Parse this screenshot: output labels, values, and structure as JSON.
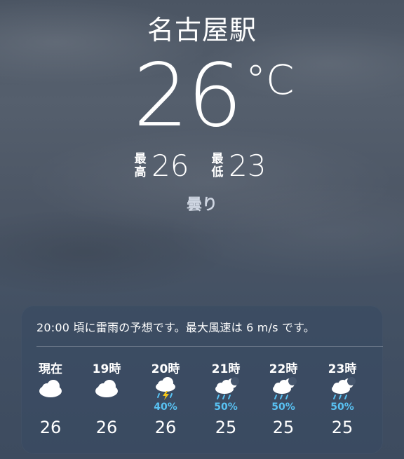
{
  "location": "名古屋駅",
  "current": {
    "temperature": "26",
    "unit": "°C",
    "high_label": "最高",
    "high": "26",
    "low_label": "最低",
    "low": "23",
    "condition": "曇り"
  },
  "forecast_card": {
    "summary": "20:00 頃に雷雨の予想です。最大風速は 6 m/s です。",
    "hours": [
      {
        "label": "現在",
        "icon": "cloud-icon",
        "precip": "",
        "temp": "26"
      },
      {
        "label": "19時",
        "icon": "cloud-icon",
        "precip": "",
        "temp": "26"
      },
      {
        "label": "20時",
        "icon": "thunderstorm-icon",
        "precip": "40%",
        "temp": "26"
      },
      {
        "label": "21時",
        "icon": "moon-rain-icon",
        "precip": "50%",
        "temp": "25"
      },
      {
        "label": "22時",
        "icon": "moon-rain-icon",
        "precip": "50%",
        "temp": "25"
      },
      {
        "label": "23時",
        "icon": "moon-rain-icon",
        "precip": "50%",
        "temp": "25"
      }
    ]
  },
  "colors": {
    "precip": "#59c2f3",
    "card_background": "#394a62"
  }
}
